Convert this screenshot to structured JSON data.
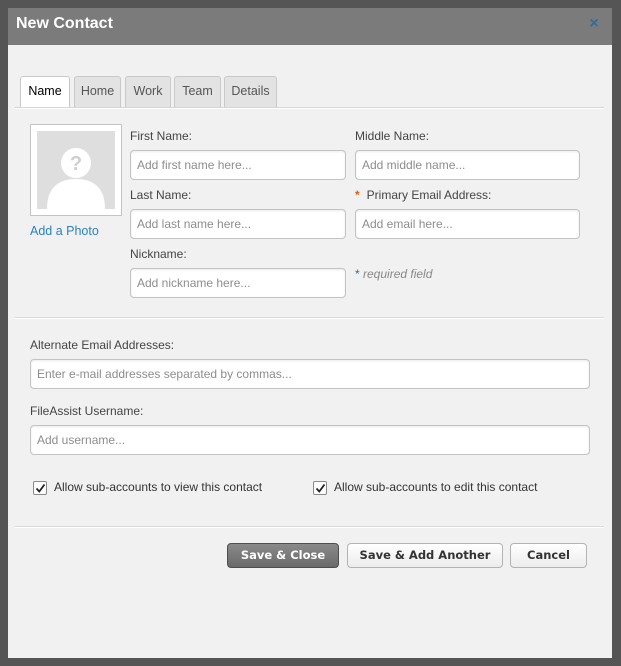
{
  "dialog": {
    "title": "New Contact",
    "close_label": "×"
  },
  "tabs": [
    {
      "label": "Name",
      "active": true
    },
    {
      "label": "Home",
      "active": false
    },
    {
      "label": "Work",
      "active": false
    },
    {
      "label": "Team",
      "active": false
    },
    {
      "label": "Details",
      "active": false
    }
  ],
  "photo": {
    "placeholder_icon": "avatar-question-icon",
    "link_label": "Add a Photo"
  },
  "fields": {
    "first_name": {
      "label": "First Name:",
      "value": "",
      "placeholder": "Add first name here..."
    },
    "middle_name": {
      "label": "Middle Name:",
      "value": "",
      "placeholder": "Add middle name..."
    },
    "last_name": {
      "label": "Last Name:",
      "value": "",
      "placeholder": "Add last name here..."
    },
    "primary_email": {
      "label": "Primary Email Address:",
      "required_marker": "*",
      "value": "",
      "placeholder": "Add email here..."
    },
    "nickname": {
      "label": "Nickname:",
      "value": "",
      "placeholder": "Add nickname here..."
    },
    "alternate_emails": {
      "label": "Alternate Email Addresses:",
      "value": "",
      "placeholder": "Enter e-mail addresses separated by commas..."
    },
    "username": {
      "label": "FileAssist Username:",
      "value": "",
      "placeholder": "Add username..."
    }
  },
  "required_note": {
    "marker": "*",
    "text": "required field"
  },
  "checkboxes": {
    "view": {
      "label": "Allow sub-accounts to view this contact",
      "checked": true
    },
    "edit": {
      "label": "Allow sub-accounts to edit this contact",
      "checked": true
    }
  },
  "buttons": {
    "save_close": "Save & Close",
    "save_add": "Save & Add Another",
    "cancel": "Cancel"
  },
  "colors": {
    "title_bar": "#7b7b7b",
    "close_icon": "#2c6e9e",
    "link": "#2a82c3",
    "required_marker": "#e05f17",
    "primary_button": "#7a7a7a"
  }
}
